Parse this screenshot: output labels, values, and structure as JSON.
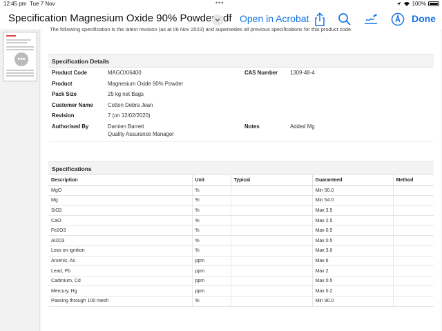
{
  "status_bar": {
    "time": "12:45 pm",
    "date": "Tue 7 Nov",
    "battery": "100%"
  },
  "toolbar": {
    "document_title": "Specification Magnesium Oxide 90% Powder.pdf",
    "open_in_acrobat": "Open in Acrobat",
    "done": "Done",
    "icons": [
      "share-icon",
      "search-icon",
      "signature-icon",
      "markup-icon"
    ]
  },
  "document": {
    "intro": "The following specification is the latest revision (as at 06 Nov 2023) and supersedes all previous specifications for this product code.",
    "details": {
      "heading": "Specification Details",
      "product_code_label": "Product Code",
      "product_code": "MAGOXI6400",
      "cas_label": "CAS Number",
      "cas": "1309-48-4",
      "product_label": "Product",
      "product": "Magnesium Oxide 90% Powder",
      "pack_size_label": "Pack Size",
      "pack_size": "25 kg net Bags",
      "customer_label": "Customer Name",
      "customer": "Cotton Debra Jean",
      "revision_label": "Revision",
      "revision": "7 (on 12/02/2020)",
      "authorised_label": "Authorised By",
      "authorised_name": "Damien Barrett",
      "authorised_title": "Quality Assurance Manager",
      "notes_label": "Notes",
      "notes": "Added Mg"
    },
    "specifications": {
      "heading": "Specifications",
      "columns": [
        "Description",
        "Unit",
        "Typical",
        "Guaranteed",
        "Method"
      ],
      "rows": [
        [
          "MgO",
          "%",
          "",
          "Min 90.0",
          ""
        ],
        [
          "Mg",
          "%",
          "",
          "Min 54.0",
          ""
        ],
        [
          "SiO2",
          "%",
          "",
          "Max 3.5",
          ""
        ],
        [
          "CaO",
          "%",
          "",
          "Max 2.5",
          ""
        ],
        [
          "Fe2O3",
          "%",
          "",
          "Max 0.5",
          ""
        ],
        [
          "Al2O3",
          "%",
          "",
          "Max 0.5",
          ""
        ],
        [
          "Loss on ignition",
          "%",
          "",
          "Max 3.0",
          ""
        ],
        [
          "Arsenic, As",
          "ppm",
          "",
          "Max 6",
          ""
        ],
        [
          "Lead, Pb",
          "ppm",
          "",
          "Max 2",
          ""
        ],
        [
          "Cadmium, Cd",
          "ppm",
          "",
          "Max 0.5",
          ""
        ],
        [
          "Mercury, Hg",
          "ppm",
          "",
          "Max 0.2",
          ""
        ],
        [
          "Passing through 100 mesh",
          "%",
          "",
          "Min 90.0",
          ""
        ]
      ]
    }
  },
  "colors": {
    "accent": "#1473e6",
    "header_bg": "#f3f3f3"
  }
}
